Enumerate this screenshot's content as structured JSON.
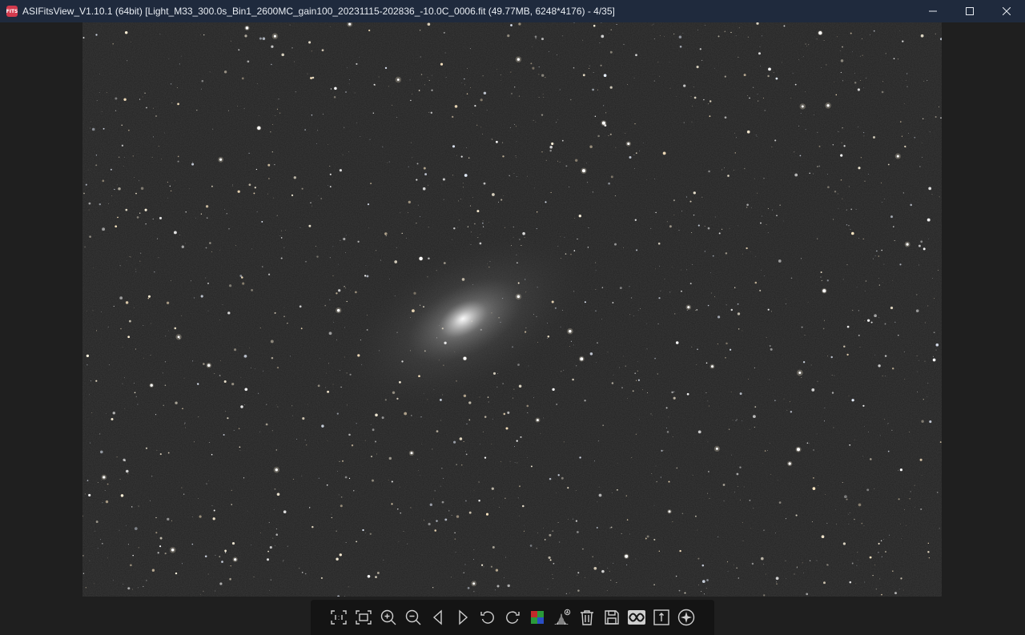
{
  "window": {
    "app_icon_text": "FITS",
    "title": "ASIFitsView_V1.10.1 (64bit) [Light_M33_300.0s_Bin1_2600MC_gain100_20231115-202836_-10.0C_0006.fit (49.77MB, 6248*4176) - 4/35]"
  },
  "toolbar": {
    "buttons": [
      {
        "name": "actual-size-icon"
      },
      {
        "name": "fit-window-icon"
      },
      {
        "name": "zoom-in-icon"
      },
      {
        "name": "zoom-out-icon"
      },
      {
        "name": "previous-image-icon"
      },
      {
        "name": "next-image-icon"
      },
      {
        "name": "rotate-left-icon"
      },
      {
        "name": "rotate-right-icon"
      },
      {
        "name": "debayer-color-icon"
      },
      {
        "name": "auto-stretch-histogram-icon"
      },
      {
        "name": "delete-icon"
      },
      {
        "name": "save-icon"
      },
      {
        "name": "image-compare-icon"
      },
      {
        "name": "info-icon"
      },
      {
        "name": "star-detect-icon"
      }
    ]
  },
  "colors": {
    "titlebar_bg": "#1f2a3d",
    "app_icon": "#d23a4e",
    "sky_bg": "#1e1e1e",
    "toolbar_bg": "#141414",
    "icon": "#cfcfcf"
  }
}
